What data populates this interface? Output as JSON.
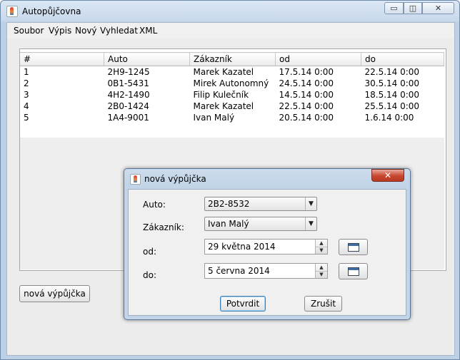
{
  "window": {
    "title": "Autopůjčovna",
    "controls": {
      "minimize": "▭",
      "maximize": "◫",
      "close": "✕"
    }
  },
  "menu": [
    "Soubor",
    "Výpis",
    "Nový",
    "Vyhledat",
    "XML"
  ],
  "table": {
    "columns": [
      "#",
      "Auto",
      "Zákazník",
      "od",
      "do"
    ],
    "rows": [
      [
        "1",
        "2H9-1245",
        "Marek Kazatel",
        "17.5.14 0:00",
        "22.5.14 0:00"
      ],
      [
        "2",
        "0B1-5431",
        "Mirek Autonomný",
        "24.5.14 0:00",
        "30.5.14 0:00"
      ],
      [
        "3",
        "4H2-1490",
        "Filip Kulečník",
        "14.5.14 0:00",
        "18.5.14 0:00"
      ],
      [
        "4",
        "2B0-1424",
        "Marek Kazatel",
        "22.5.14 0:00",
        "25.5.14 0:00"
      ],
      [
        "5",
        "1A4-9001",
        "Ivan Malý",
        "20.5.14 0:00",
        "1.6.14 0:00"
      ]
    ]
  },
  "new_loan_button": "nová výpůjčka",
  "dialog": {
    "title": "nová výpůjčka",
    "close": "✕",
    "fields": {
      "auto_label": "Auto:",
      "auto_value": "2B2-8532",
      "customer_label": "Zákazník:",
      "customer_value": "Ivan Malý",
      "from_label": "od:",
      "from_value": "29 května 2014",
      "to_label": "do:",
      "to_value": "5 června 2014"
    },
    "confirm": "Potvrdit",
    "cancel": "Zrušit"
  },
  "icons": {
    "dropdown": "▼",
    "spin_up": "▲",
    "spin_down": "▼"
  }
}
